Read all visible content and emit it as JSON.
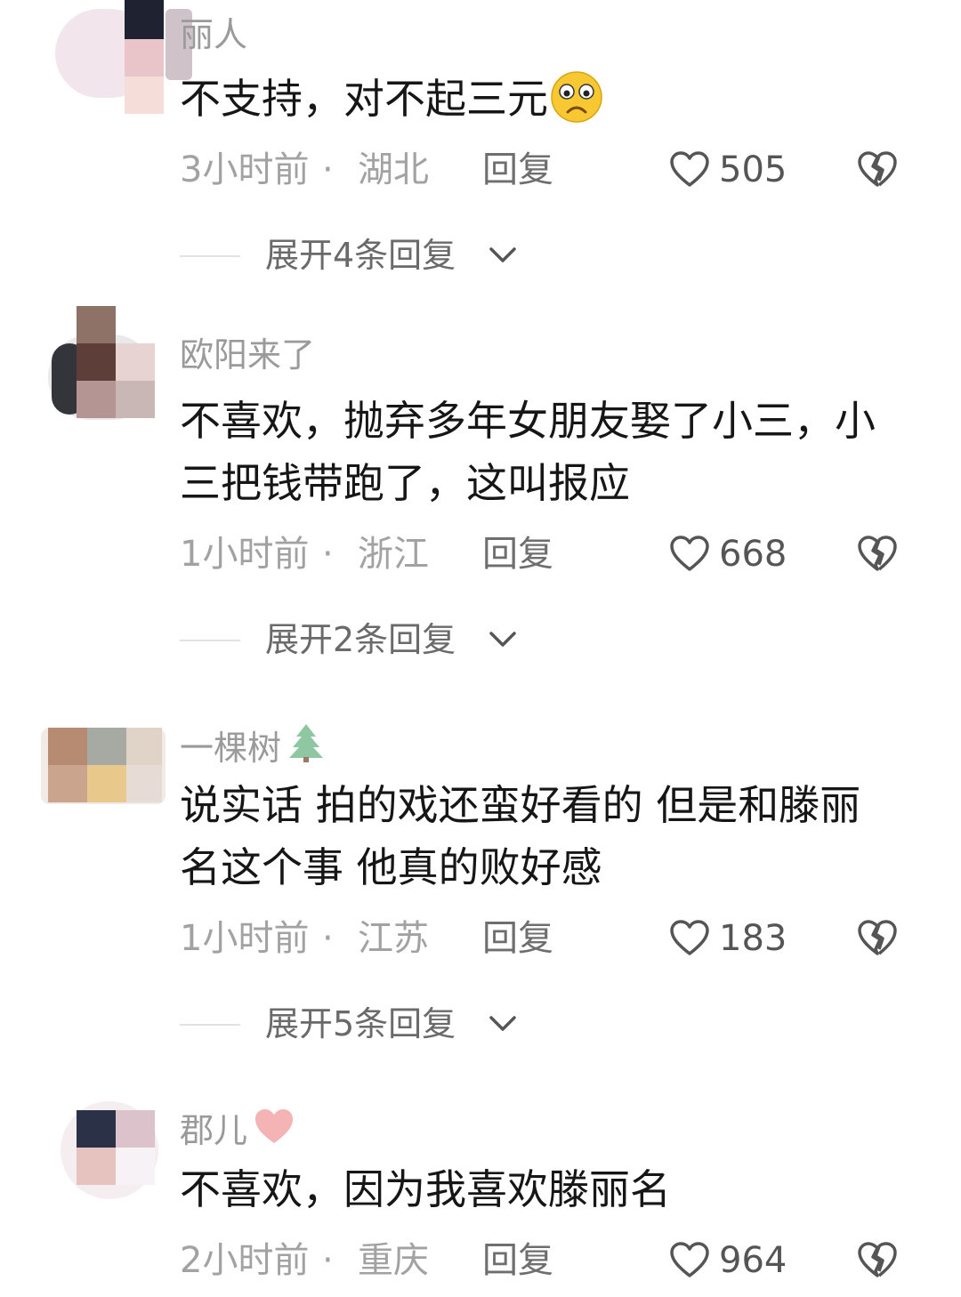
{
  "comments": [
    {
      "username": "丽人",
      "text": "不支持，对不起三元",
      "time": "3小时前",
      "separator": "·",
      "region": "湖北",
      "reply_label": "回复",
      "likes": "505",
      "expand_label": "展开4条回复"
    },
    {
      "username": "欧阳来了",
      "text": "不喜欢，抛弃多年女朋友娶了小三，小三把钱带跑了，这叫报应",
      "time": "1小时前",
      "separator": "·",
      "region": "浙江",
      "reply_label": "回复",
      "likes": "668",
      "expand_label": "展开2条回复"
    },
    {
      "username": "一棵树",
      "text": "说实话 拍的戏还蛮好看的 但是和滕丽名这个事 他真的败好感",
      "time": "1小时前",
      "separator": "·",
      "region": "江苏",
      "reply_label": "回复",
      "likes": "183",
      "expand_label": "展开5条回复"
    },
    {
      "username": "郡儿",
      "text": "不喜欢，因为我喜欢滕丽名",
      "time": "2小时前",
      "separator": "·",
      "region": "重庆",
      "reply_label": "回复",
      "likes": "964"
    }
  ],
  "icons": {
    "like": "heart-outline-icon",
    "dislike": "broken-heart-icon",
    "expand": "chevron-down-icon",
    "emoji_1": "frowning-face-emoji",
    "badge_3": "christmas-tree-emoji",
    "badge_4": "pink-heart-emoji"
  }
}
